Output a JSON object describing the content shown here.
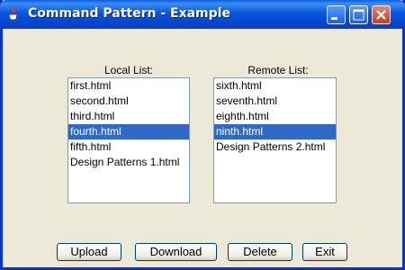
{
  "window": {
    "title": "Command Pattern - Example"
  },
  "local": {
    "label": "Local List:",
    "items": [
      "first.html",
      "second.html",
      "third.html",
      "fourth.html",
      "fifth.html",
      "Design Patterns 1.html"
    ],
    "selected_item": "fourth.html"
  },
  "remote": {
    "label": "Remote List:",
    "items": [
      "sixth.html",
      "seventh.html",
      "eighth.html",
      "ninth.html",
      "Design Patterns 2.html"
    ],
    "selected_item": "ninth.html"
  },
  "buttons": {
    "upload": "Upload",
    "download": "Download",
    "delete": "Delete",
    "exit": "Exit"
  },
  "icons": {
    "app": "java-coffee-cup-icon",
    "minimize": "minimize-icon",
    "maximize": "maximize-icon",
    "close": "close-icon"
  },
  "colors": {
    "titlebar": "#0a58dc",
    "selection": "#3169c6",
    "close_button": "#c93b1d",
    "window_background": "#ece9d8"
  }
}
